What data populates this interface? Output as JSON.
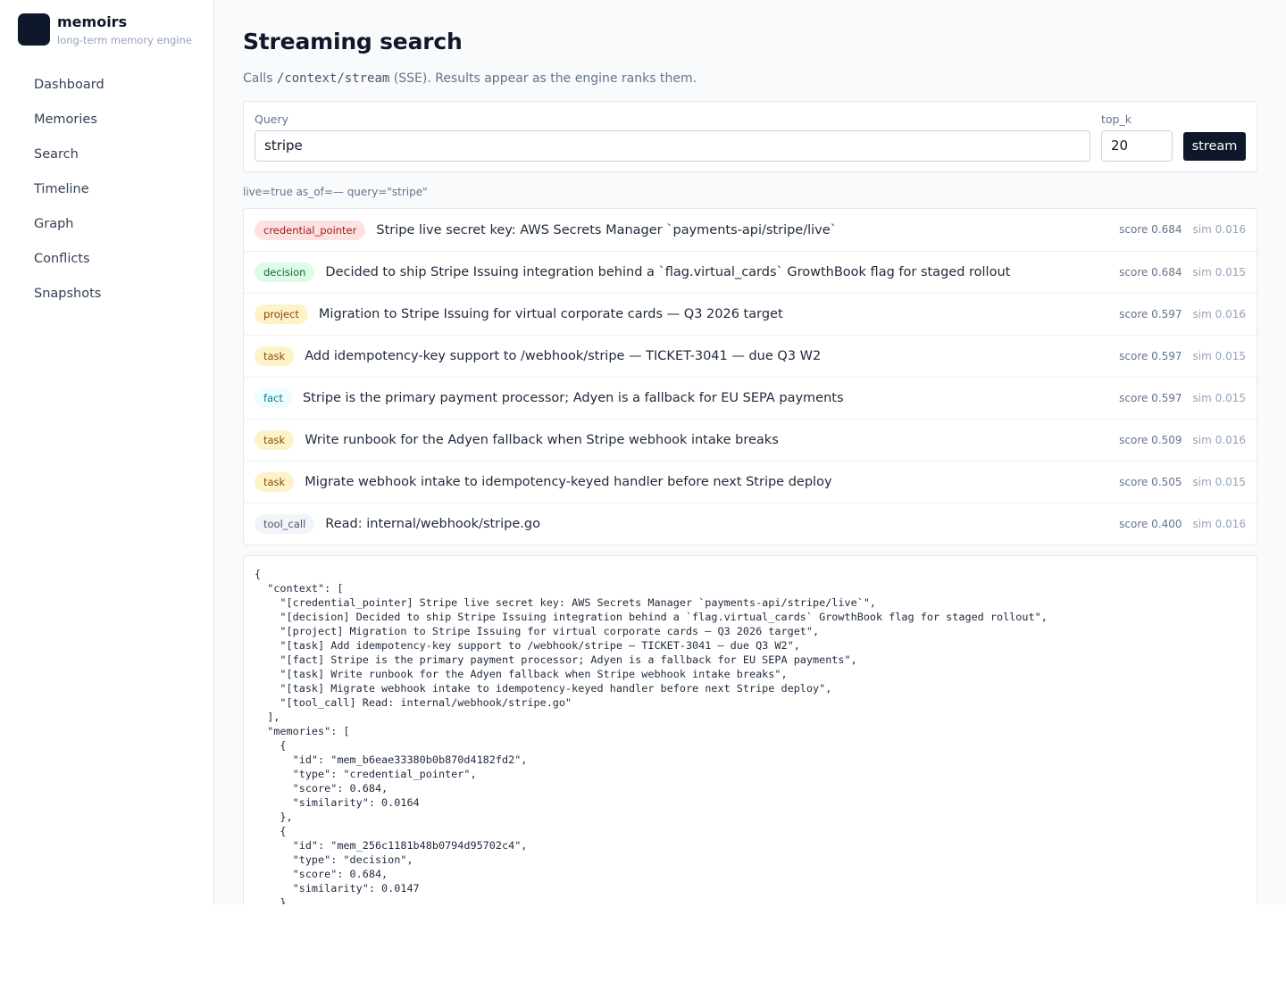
{
  "brand": {
    "name": "memoirs",
    "subtitle": "long-term memory engine"
  },
  "nav": [
    {
      "label": "Dashboard",
      "name": "dashboard"
    },
    {
      "label": "Memories",
      "name": "memories"
    },
    {
      "label": "Search",
      "name": "search"
    },
    {
      "label": "Timeline",
      "name": "timeline"
    },
    {
      "label": "Graph",
      "name": "graph"
    },
    {
      "label": "Conflicts",
      "name": "conflicts"
    },
    {
      "label": "Snapshots",
      "name": "snapshots"
    }
  ],
  "page": {
    "title": "Streaming search",
    "desc_prefix": "Calls ",
    "desc_code": "/context/stream",
    "desc_suffix": " (SSE). Results appear as the engine ranks them."
  },
  "form": {
    "query_label": "Query",
    "query_value": "stripe",
    "topk_label": "top_k",
    "topk_value": "20",
    "stream_label": "stream"
  },
  "status": "live=true as_of=— query=\"stripe\"",
  "tag_colors": {
    "credential_pointer": {
      "bg": "#fee2e2",
      "fg": "#991b1b"
    },
    "decision": {
      "bg": "#dcfce7",
      "fg": "#166534"
    },
    "project": {
      "bg": "#fef3c7",
      "fg": "#92400e"
    },
    "task": {
      "bg": "#fef3c7",
      "fg": "#854d0e"
    },
    "fact": {
      "bg": "#ecfeff",
      "fg": "#0e7490"
    },
    "tool_call": {
      "bg": "#f1f5f9",
      "fg": "#475569"
    }
  },
  "results": [
    {
      "type": "credential_pointer",
      "text": "Stripe live secret key: AWS Secrets Manager `payments-api/stripe/live`",
      "score": "score 0.684",
      "sim": "sim 0.016"
    },
    {
      "type": "decision",
      "text": "Decided to ship Stripe Issuing integration behind a `flag.virtual_cards` GrowthBook flag for staged rollout",
      "score": "score 0.684",
      "sim": "sim 0.015"
    },
    {
      "type": "project",
      "text": "Migration to Stripe Issuing for virtual corporate cards — Q3 2026 target",
      "score": "score 0.597",
      "sim": "sim 0.016"
    },
    {
      "type": "task",
      "text": "Add idempotency-key support to /webhook/stripe — TICKET-3041 — due Q3 W2",
      "score": "score 0.597",
      "sim": "sim 0.015"
    },
    {
      "type": "fact",
      "text": "Stripe is the primary payment processor; Adyen is a fallback for EU SEPA payments",
      "score": "score 0.597",
      "sim": "sim 0.015"
    },
    {
      "type": "task",
      "text": "Write runbook for the Adyen fallback when Stripe webhook intake breaks",
      "score": "score 0.509",
      "sim": "sim 0.016"
    },
    {
      "type": "task",
      "text": "Migrate webhook intake to idempotency-keyed handler before next Stripe deploy",
      "score": "score 0.505",
      "sim": "sim 0.015"
    },
    {
      "type": "tool_call",
      "text": "Read: internal/webhook/stripe.go",
      "score": "score 0.400",
      "sim": "sim 0.016"
    }
  ],
  "json_output": "{\n  \"context\": [\n    \"[credential_pointer] Stripe live secret key: AWS Secrets Manager `payments-api/stripe/live`\",\n    \"[decision] Decided to ship Stripe Issuing integration behind a `flag.virtual_cards` GrowthBook flag for staged rollout\",\n    \"[project] Migration to Stripe Issuing for virtual corporate cards — Q3 2026 target\",\n    \"[task] Add idempotency-key support to /webhook/stripe — TICKET-3041 — due Q3 W2\",\n    \"[fact] Stripe is the primary payment processor; Adyen is a fallback for EU SEPA payments\",\n    \"[task] Write runbook for the Adyen fallback when Stripe webhook intake breaks\",\n    \"[task] Migrate webhook intake to idempotency-keyed handler before next Stripe deploy\",\n    \"[tool_call] Read: internal/webhook/stripe.go\"\n  ],\n  \"memories\": [\n    {\n      \"id\": \"mem_b6eae33380b0b870d4182fd2\",\n      \"type\": \"credential_pointer\",\n      \"score\": 0.684,\n      \"similarity\": 0.0164\n    },\n    {\n      \"id\": \"mem_256c1181b48b0794d95702c4\",\n      \"type\": \"decision\",\n      \"score\": 0.684,\n      \"similarity\": 0.0147\n    },"
}
